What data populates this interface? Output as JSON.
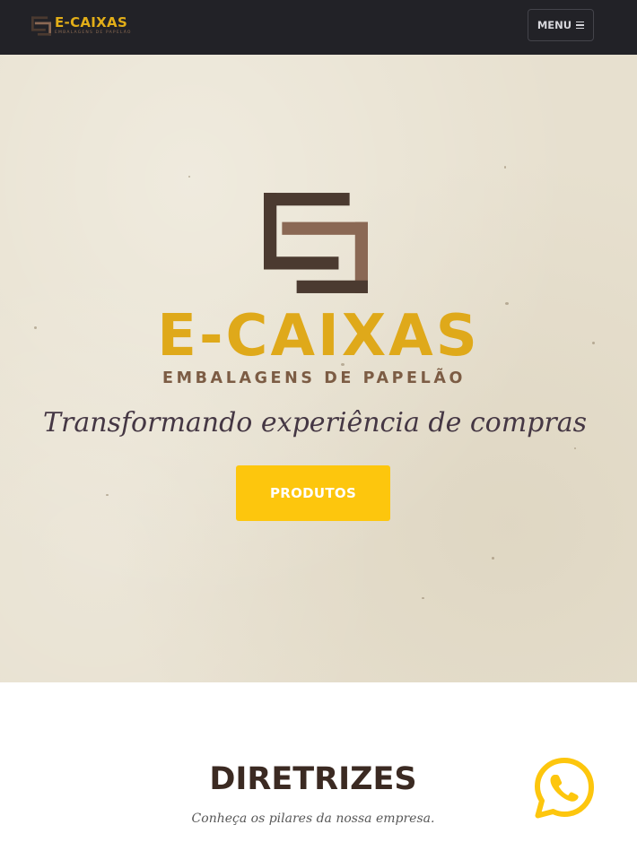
{
  "navbar": {
    "brand_title": "E-CAIXAS",
    "brand_subtitle": "EMBALAGENS DE PAPELÃO",
    "menu_label": "MENU",
    "menu_icon": "hamburger-icon"
  },
  "hero": {
    "logo_icon": "e-caixas-logo-icon",
    "title": "E-CAIXAS",
    "subtitle": "EMBALAGENS DE PAPELÃO",
    "tagline": "Transformando experiência de compras",
    "button_label": "PRODUTOS"
  },
  "guidelines": {
    "title": "DIRETRIZES",
    "subtitle": "Conheça os pilares da nossa empresa."
  },
  "whatsapp": {
    "icon": "whatsapp-icon"
  },
  "colors": {
    "navbar_bg": "#222227",
    "brand_gold": "#dfa91a",
    "brand_brown_dark": "#4b3a30",
    "brand_brown_light": "#8a6854",
    "button_yellow": "#fdc60d",
    "hero_bg": "#e7e0cf",
    "heading_dark": "#3b2a22"
  }
}
